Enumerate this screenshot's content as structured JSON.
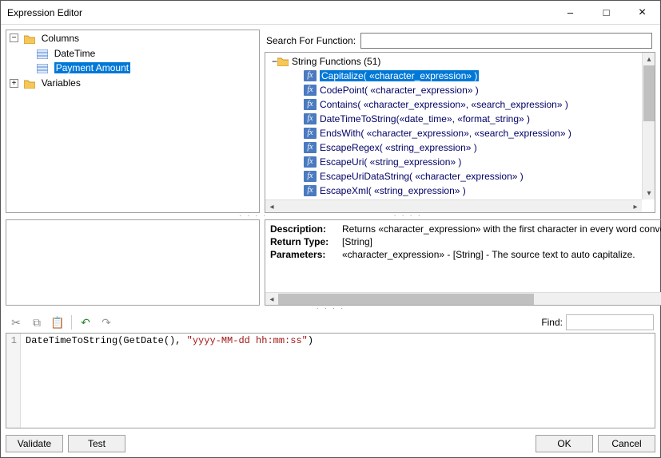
{
  "window": {
    "title": "Expression Editor"
  },
  "left_tree": {
    "columns_label": "Columns",
    "variables_label": "Variables",
    "columns_children": [
      {
        "label": "DateTime",
        "selected": false
      },
      {
        "label": "Payment Amount",
        "selected": true
      }
    ]
  },
  "search": {
    "label": "Search For Function:",
    "value": ""
  },
  "functions": {
    "category_label": "String Functions (51)",
    "items": [
      {
        "label": "Capitalize( «character_expression» )",
        "selected": true
      },
      {
        "label": "CodePoint( «character_expression» )"
      },
      {
        "label": "Contains( «character_expression», «search_expression» )"
      },
      {
        "label": "DateTimeToString(«date_time», «format_string» )"
      },
      {
        "label": "EndsWith( «character_expression», «search_expression» )"
      },
      {
        "label": "EscapeRegex( «string_expression» )"
      },
      {
        "label": "EscapeUri( «string_expression» )"
      },
      {
        "label": "EscapeUriDataString( «character_expression» )"
      },
      {
        "label": "EscapeXml( «string_expression» )"
      }
    ]
  },
  "description": {
    "desc_label": "Description:",
    "desc_value": "Returns «character_expression» with the first character in every word converted to u",
    "return_label": "Return Type:",
    "return_value": "[String]",
    "params_label": "Parameters:",
    "params_value": "«character_expression» - [String] - The source text to auto capitalize."
  },
  "toolbar": {
    "find_label": "Find:",
    "find_value": ""
  },
  "editor": {
    "line_number": "1",
    "code_ident": "DateTimeToString(GetDate(), ",
    "code_string": "\"yyyy-MM-dd hh:mm:ss\"",
    "code_tail": ")"
  },
  "buttons": {
    "validate": "Validate",
    "test": "Test",
    "ok": "OK",
    "cancel": "Cancel"
  }
}
